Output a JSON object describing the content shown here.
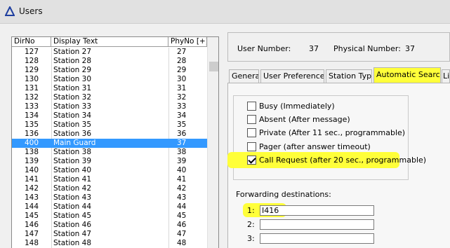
{
  "window": {
    "title": "Users"
  },
  "colors": {
    "highlight": "#ffff3a",
    "selection": "#3399ff"
  },
  "list": {
    "headers": {
      "dir": "DirNo",
      "display": "Display Text",
      "phy": "PhyNo [+]"
    },
    "rows": [
      {
        "dir": "127",
        "display": "Station 27",
        "phy": "27"
      },
      {
        "dir": "128",
        "display": "Station 28",
        "phy": "28"
      },
      {
        "dir": "129",
        "display": "Station 29",
        "phy": "29"
      },
      {
        "dir": "130",
        "display": "Station 30",
        "phy": "30"
      },
      {
        "dir": "131",
        "display": "Station 31",
        "phy": "31"
      },
      {
        "dir": "132",
        "display": "Station 32",
        "phy": "32"
      },
      {
        "dir": "133",
        "display": "Station 33",
        "phy": "33"
      },
      {
        "dir": "134",
        "display": "Station 34",
        "phy": "34"
      },
      {
        "dir": "135",
        "display": "Station 35",
        "phy": "35"
      },
      {
        "dir": "136",
        "display": "Station 36",
        "phy": "36"
      },
      {
        "dir": "400",
        "display": "Main Guard",
        "phy": "37",
        "selected": true
      },
      {
        "dir": "138",
        "display": "Station 38",
        "phy": "38"
      },
      {
        "dir": "139",
        "display": "Station 39",
        "phy": "39"
      },
      {
        "dir": "140",
        "display": "Station 40",
        "phy": "40"
      },
      {
        "dir": "141",
        "display": "Station 41",
        "phy": "41"
      },
      {
        "dir": "142",
        "display": "Station 42",
        "phy": "42"
      },
      {
        "dir": "143",
        "display": "Station 43",
        "phy": "43"
      },
      {
        "dir": "144",
        "display": "Station 44",
        "phy": "44"
      },
      {
        "dir": "145",
        "display": "Station 45",
        "phy": "45"
      },
      {
        "dir": "146",
        "display": "Station 46",
        "phy": "46"
      },
      {
        "dir": "147",
        "display": "Station 47",
        "phy": "47"
      },
      {
        "dir": "148",
        "display": "Station 48",
        "phy": "48"
      }
    ]
  },
  "info": {
    "user_number_label": "User Number:",
    "user_number": "37",
    "physical_number_label": "Physical Number:",
    "physical_number": "37"
  },
  "tabs": [
    {
      "label": "General"
    },
    {
      "label": "User Preferences"
    },
    {
      "label": "Station Type"
    },
    {
      "label": "Automatic Search",
      "active": true
    },
    {
      "label": "Li"
    }
  ],
  "search_options": [
    {
      "label": "Busy (Immediately)",
      "checked": false
    },
    {
      "label": "Absent (After message)",
      "checked": false
    },
    {
      "label": "Private (After 11 sec., programmable)",
      "checked": false
    },
    {
      "label": "Pager (after answer timeout)",
      "checked": false
    },
    {
      "label": "Call Request (after 20 sec., programmable)",
      "checked": true
    }
  ],
  "forwarding": {
    "title": "Forwarding destinations:",
    "entries": [
      {
        "num": "1:",
        "value": "I416"
      },
      {
        "num": "2:",
        "value": ""
      },
      {
        "num": "3:",
        "value": ""
      }
    ]
  }
}
